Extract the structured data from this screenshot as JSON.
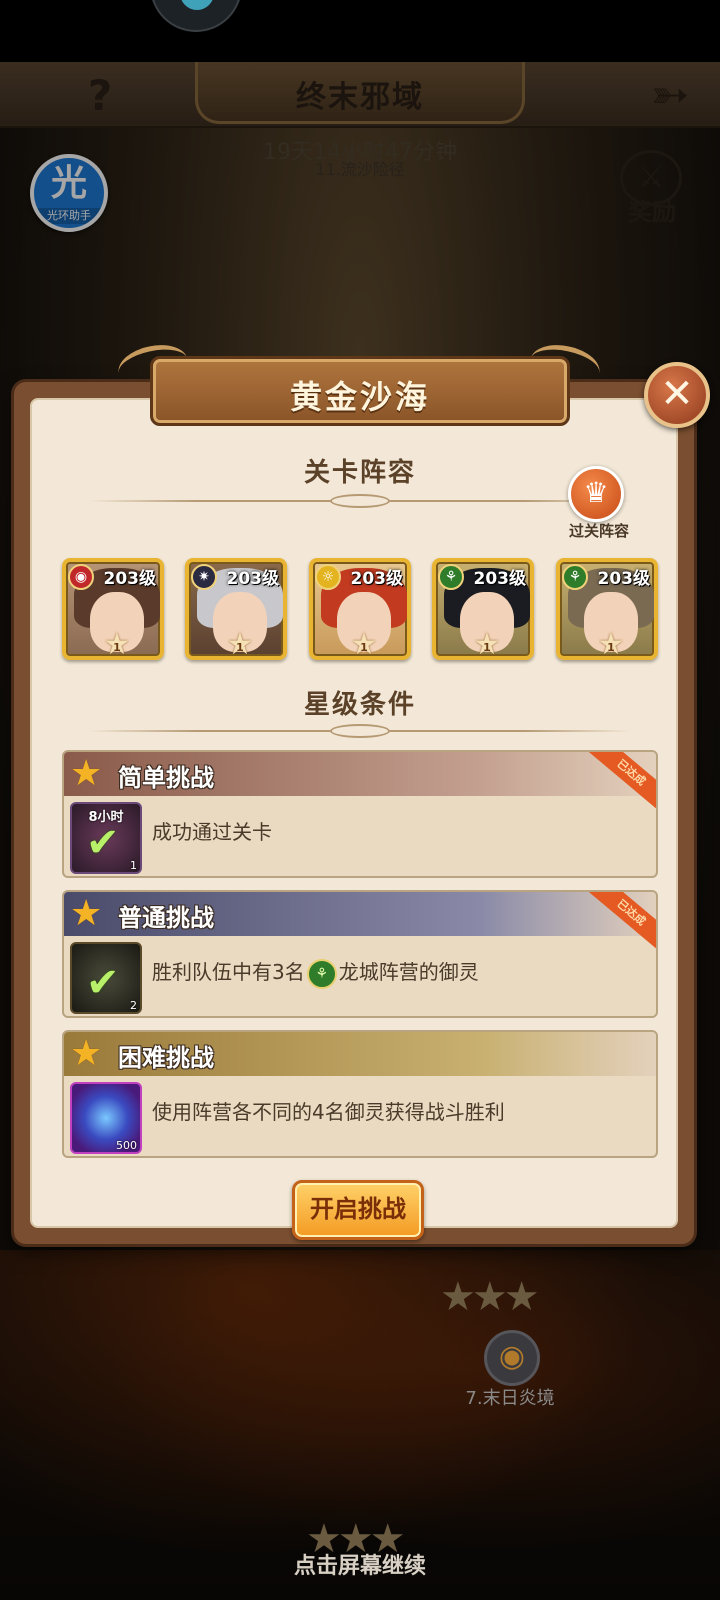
{
  "header": {
    "title": "终末邪域",
    "timer": "19天14小时47分钟",
    "stage_above": "11.流沙险径",
    "reward_label": "奖励"
  },
  "helper": {
    "char": "光",
    "label": "光环助手"
  },
  "dialog": {
    "title": "黄金沙海",
    "lineup_title": "关卡阵容",
    "clear_lineup_label": "过关阵容",
    "star_conditions_title": "星级条件",
    "heroes": [
      {
        "level": "203级",
        "stars": "1",
        "faction": "fire",
        "faction_color": "#c0282a",
        "hair_color": "#5a3a2a"
      },
      {
        "level": "203级",
        "stars": "1",
        "faction": "dark",
        "faction_color": "#2a2a40",
        "hair_color": "#c8c8cc"
      },
      {
        "level": "203级",
        "stars": "1",
        "faction": "light",
        "faction_color": "#e4b420",
        "hair_color": "#c23a20"
      },
      {
        "level": "203级",
        "stars": "1",
        "faction": "dragon",
        "faction_color": "#2f7d2a",
        "hair_color": "#1a1c22"
      },
      {
        "level": "203级",
        "stars": "1",
        "faction": "dragon",
        "faction_color": "#2f7d2a",
        "hair_color": "#7a6a52"
      }
    ],
    "conditions": [
      {
        "title": "简单挑战",
        "status": "已达成",
        "icon_label": "8小时",
        "icon_count": "1",
        "text": "成功通过关卡",
        "header_color": "#a27a6c"
      },
      {
        "title": "普通挑战",
        "status": "已达成",
        "icon_label": "",
        "icon_count": "2",
        "text_before": "胜利队伍中有3名",
        "text_after": "龙城阵营的御灵",
        "header_color": "#6e6e8e"
      },
      {
        "title": "困难挑战",
        "status": "",
        "icon_label": "",
        "icon_count": "500",
        "text": "使用阵营各不同的4名御灵获得战斗胜利",
        "header_color": "#b59a58"
      }
    ],
    "start_button": "开启挑战"
  },
  "map": {
    "stage_below": "7.末日炎境",
    "continue_hint": "点击屏幕继续"
  },
  "icons": {
    "help": "question-mark-icon",
    "back": "bow-arrow-icon",
    "close": "close-icon",
    "crown": "crown-icon",
    "star": "star-icon",
    "check": "check-icon"
  }
}
